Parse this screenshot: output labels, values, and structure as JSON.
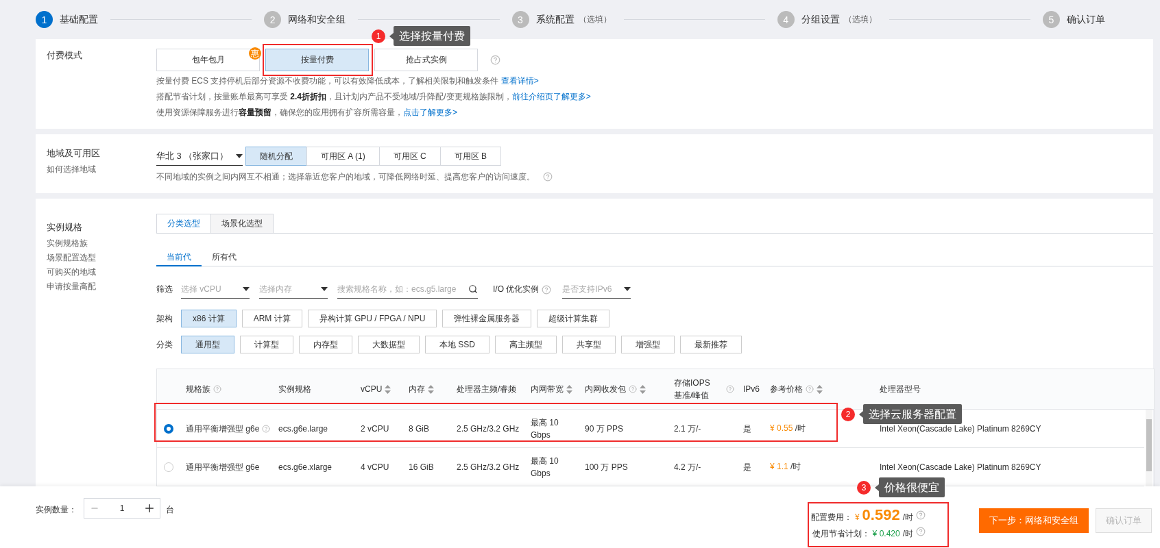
{
  "steps": [
    {
      "number": "1",
      "label": "基础配置",
      "active": true
    },
    {
      "number": "2",
      "label": "网络和安全组",
      "active": false
    },
    {
      "number": "3",
      "label": "系统配置",
      "note": "（选填）",
      "active": false
    },
    {
      "number": "4",
      "label": "分组设置",
      "note": "（选填）",
      "active": false
    },
    {
      "number": "5",
      "label": "确认订单",
      "active": false
    }
  ],
  "payment": {
    "label": "付费模式",
    "options": [
      {
        "label": "包年包月",
        "selected": false,
        "badge": "惠"
      },
      {
        "label": "按量付费",
        "selected": true
      },
      {
        "label": "抢占式实例",
        "selected": false
      }
    ],
    "notes": [
      {
        "text": "按量付费 ECS 支持停机后部分资源不收费功能，可以有效降低成本，了解相关限制和触发条件 ",
        "link": "查看详情>"
      },
      {
        "text": "搭配节省计划，按量账单最高可享受 **2.4折折扣**，且计划内产品不受地域/升降配/变更规格族限制，",
        "link": "前往介绍页了解更多>"
      },
      {
        "text": "使用资源保障服务进行**容量预留**，确保您的应用拥有扩容所需容量，",
        "link": "点击了解更多>"
      }
    ]
  },
  "region": {
    "label": "地域及可用区",
    "help_link": "如何选择地域",
    "value": "华北 3 （张家口）",
    "zones": [
      {
        "label": "随机分配",
        "selected": true
      },
      {
        "label": "可用区 A (1)",
        "selected": false
      },
      {
        "label": "可用区 C",
        "selected": false
      },
      {
        "label": "可用区 B",
        "selected": false
      }
    ],
    "note": "不同地域的实例之间内网互不相通；选择靠近您客户的地域，可降低网络时延、提高您客户的访问速度。"
  },
  "spec": {
    "label": "实例规格",
    "links": [
      "实例规格族",
      "场景配置选型",
      "可购买的地域",
      "申请按量高配"
    ],
    "tabs": [
      {
        "label": "分类选型",
        "selected": true
      },
      {
        "label": "场景化选型",
        "selected": false
      }
    ],
    "generations": [
      {
        "label": "当前代",
        "selected": true
      },
      {
        "label": "所有代",
        "selected": false
      }
    ],
    "filter_label": "筛选",
    "filters": [
      {
        "kind": "select",
        "placeholder": "选择 vCPU"
      },
      {
        "kind": "select",
        "placeholder": "选择内存"
      },
      {
        "kind": "search",
        "placeholder": "搜索规格名称，如：ecs.g5.large"
      },
      {
        "kind": "label",
        "text": "I/O 优化实例"
      },
      {
        "kind": "select",
        "placeholder": "是否支持IPv6"
      }
    ],
    "arch_label": "架构",
    "arch": [
      {
        "label": "x86 计算",
        "selected": true
      },
      {
        "label": "ARM 计算",
        "selected": false
      },
      {
        "label": "异构计算 GPU / FPGA / NPU",
        "selected": false
      },
      {
        "label": "弹性裸金属服务器",
        "selected": false
      },
      {
        "label": "超级计算集群",
        "selected": false
      }
    ],
    "category_label": "分类",
    "categories": [
      {
        "label": "通用型",
        "selected": true
      },
      {
        "label": "计算型",
        "selected": false
      },
      {
        "label": "内存型",
        "selected": false
      },
      {
        "label": "大数据型",
        "selected": false
      },
      {
        "label": "本地 SSD",
        "selected": false
      },
      {
        "label": "高主频型",
        "selected": false
      },
      {
        "label": "共享型",
        "selected": false
      },
      {
        "label": "增强型",
        "selected": false
      },
      {
        "label": "最新推荐",
        "selected": false
      }
    ],
    "table": {
      "columns": [
        {
          "label": "规格族",
          "sortable": false,
          "help": true
        },
        {
          "label": "实例规格",
          "sortable": false,
          "help": false
        },
        {
          "label": "vCPU",
          "sortable": true,
          "help": false
        },
        {
          "label": "内存",
          "sortable": true,
          "help": false
        },
        {
          "label": "处理器主频/睿频",
          "sortable": false,
          "help": false
        },
        {
          "label": "内网带宽",
          "sortable": true,
          "help": false
        },
        {
          "label": "内网收发包",
          "sortable": true,
          "help": true
        },
        {
          "label": "存储IOPS 基准/峰值",
          "sortable": false,
          "help": true
        },
        {
          "label": "IPv6",
          "sortable": false,
          "help": false
        },
        {
          "label": "参考价格",
          "sortable": true,
          "help": true
        },
        {
          "label": "处理器型号",
          "sortable": false,
          "help": false
        }
      ],
      "rows": [
        {
          "selected": true,
          "family": "通用平衡增强型 g6e",
          "family_help": true,
          "spec": "ecs.g6e.large",
          "vcpu": "2 vCPU",
          "memory": "8 GiB",
          "freq": "2.5 GHz/3.2 GHz",
          "bandwidth": "最高 10 Gbps",
          "pps": "90 万 PPS",
          "iops": "2.1 万/-",
          "ipv6": "是",
          "currency": "¥",
          "price": "0.55",
          "unit": "/时",
          "model": "Intel Xeon(Cascade Lake) Platinum 8269CY"
        },
        {
          "selected": false,
          "family": "通用平衡增强型 g6e",
          "family_help": false,
          "spec": "ecs.g6e.xlarge",
          "vcpu": "4 vCPU",
          "memory": "16 GiB",
          "freq": "2.5 GHz/3.2 GHz",
          "bandwidth": "最高 10 Gbps",
          "pps": "100 万 PPS",
          "iops": "4.2 万/-",
          "ipv6": "是",
          "currency": "¥",
          "price": "1.1",
          "unit": "/时",
          "model": "Intel Xeon(Cascade Lake) Platinum 8269CY"
        }
      ]
    }
  },
  "footer": {
    "quantity_label": "实例数量：",
    "quantity": "1",
    "quantity_unit": "台",
    "price_label": "配置费用：",
    "currency": "¥",
    "price": "0.592",
    "unit": "/时",
    "plan_label": "使用节省计划：",
    "plan_currency": "¥",
    "plan_price": "0.420",
    "plan_unit": "/时",
    "buttons": [
      {
        "label": "下一步：网络和安全组",
        "disabled": false
      },
      {
        "label": "确认订单",
        "disabled": true
      }
    ]
  },
  "annotations": [
    {
      "number": "1",
      "text": "选择按量付费"
    },
    {
      "number": "2",
      "text": "选择云服务器配置"
    },
    {
      "number": "3",
      "text": "价格很便宜"
    }
  ]
}
